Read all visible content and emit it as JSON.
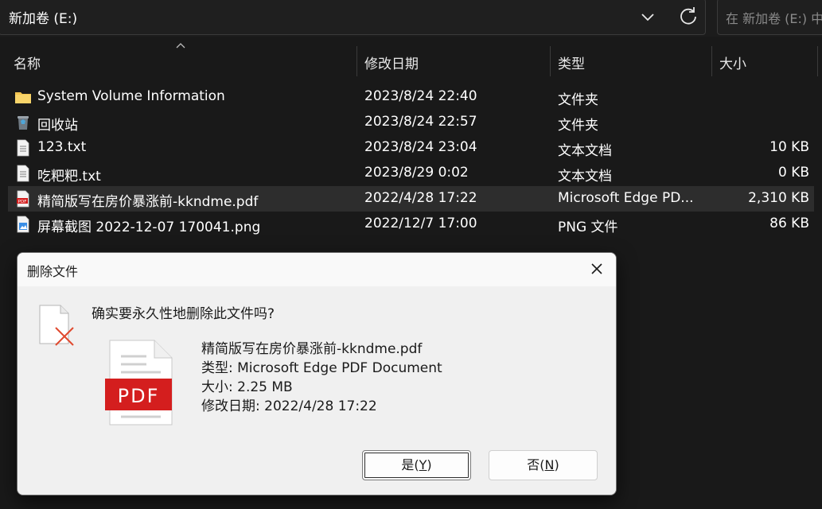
{
  "address_bar": {
    "path": "新加卷 (E:)"
  },
  "search": {
    "placeholder": "在 新加卷 (E:) 中搜索"
  },
  "columns": {
    "name": "名称",
    "date": "修改日期",
    "type": "类型",
    "size": "大小"
  },
  "files": [
    {
      "icon": "folder-icon",
      "name": "System Volume Information",
      "date": "2023/8/24 22:40",
      "type": "文件夹",
      "size": ""
    },
    {
      "icon": "recycle-bin-icon",
      "name": "回收站",
      "date": "2023/8/24 22:57",
      "type": "文件夹",
      "size": ""
    },
    {
      "icon": "text-file-icon",
      "name": "123.txt",
      "date": "2023/8/24 23:04",
      "type": "文本文档",
      "size": "10 KB"
    },
    {
      "icon": "text-file-icon",
      "name": "吃粑粑.txt",
      "date": "2023/8/29 0:02",
      "type": "文本文档",
      "size": "0 KB"
    },
    {
      "icon": "pdf-file-icon",
      "name": "精简版写在房价暴涨前-kkndme.pdf",
      "date": "2022/4/28 17:22",
      "type": "Microsoft Edge PD...",
      "size": "2,310 KB"
    },
    {
      "icon": "image-file-icon",
      "name": "屏幕截图 2022-12-07 170041.png",
      "date": "2022/12/7 17:00",
      "type": "PNG 文件",
      "size": "86 KB"
    }
  ],
  "dialog": {
    "title": "删除文件",
    "question": "确实要永久性地删除此文件吗?",
    "file_name": "精简版写在房价暴涨前-kkndme.pdf",
    "file_type": "类型: Microsoft Edge PDF Document",
    "file_size": "大小: 2.25 MB",
    "file_date": "修改日期: 2022/4/28 17:22",
    "pdf_label": "PDF",
    "yes_prefix": "是(",
    "yes_key": "Y",
    "yes_suffix": ")",
    "no_prefix": "否(",
    "no_key": "N",
    "no_suffix": ")"
  },
  "colors": {
    "background": "#191919",
    "selected_row": "#2d2d2d",
    "folder": "#f2c450",
    "pdf_red": "#d41e1e",
    "delete_x": "#e04a2f",
    "dialog_bg": "#f0f0f0"
  }
}
